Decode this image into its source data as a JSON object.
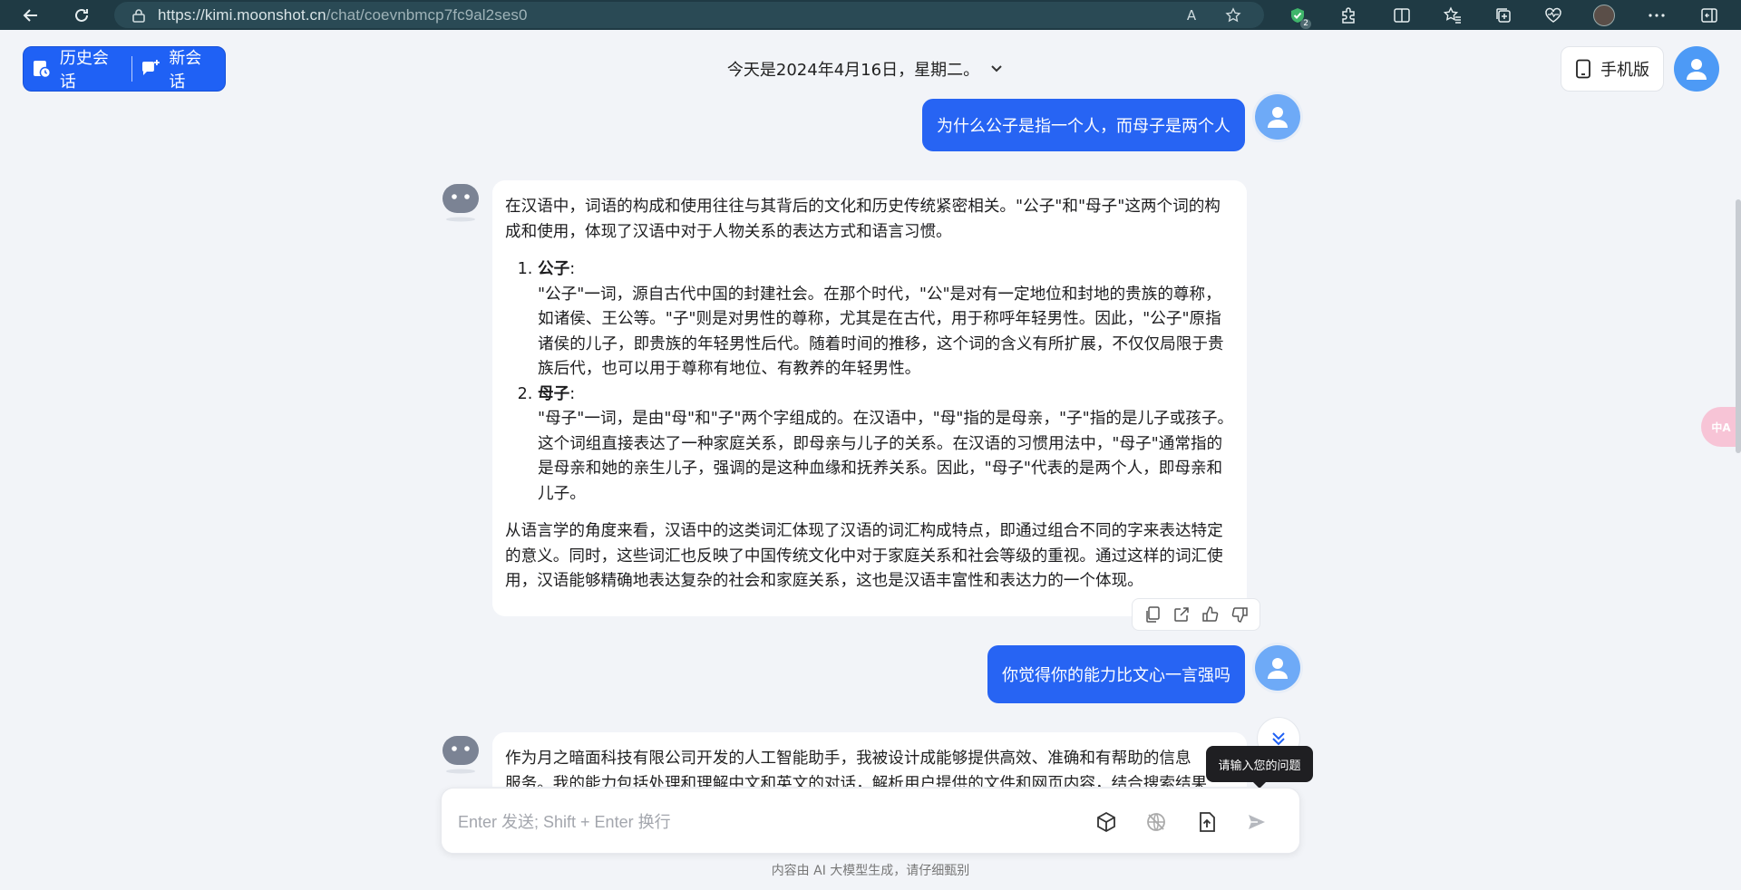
{
  "browser": {
    "url_host": "https://kimi.moonshot.cn",
    "url_path": "/chat/coevnbmcp7fc9al2ses0",
    "extension_badge": "2",
    "read_aloud_label": "A"
  },
  "header": {
    "history_label": "历史会话",
    "new_chat_label": "新会话",
    "date_title": "今天是2024年4月16日，星期二。",
    "mobile_label": "手机版"
  },
  "messages": {
    "user1": "为什么公子是指一个人，而母子是两个人",
    "bot1": {
      "intro": "在汉语中，词语的构成和使用往往与其背后的文化和历史传统紧密相关。\"公子\"和\"母子\"这两个词的构成和使用，体现了汉语中对于人物关系的表达方式和语言习惯。",
      "items": [
        {
          "title": "公子",
          "colon": ":",
          "body": "\"公子\"一词，源自古代中国的封建社会。在那个时代，\"公\"是对有一定地位和封地的贵族的尊称，如诸侯、王公等。\"子\"则是对男性的尊称，尤其是在古代，用于称呼年轻男性。因此，\"公子\"原指诸侯的儿子，即贵族的年轻男性后代。随着时间的推移，这个词的含义有所扩展，不仅仅局限于贵族后代，也可以用于尊称有地位、有教养的年轻男性。"
        },
        {
          "title": "母子",
          "colon": ":",
          "body": "\"母子\"一词，是由\"母\"和\"子\"两个字组成的。在汉语中，\"母\"指的是母亲，\"子\"指的是儿子或孩子。这个词组直接表达了一种家庭关系，即母亲与儿子的关系。在汉语的习惯用法中，\"母子\"通常指的是母亲和她的亲生儿子，强调的是这种血缘和抚养关系。因此，\"母子\"代表的是两个人，即母亲和儿子。"
        }
      ],
      "outro": "从语言学的角度来看，汉语中的这类词汇体现了汉语的词汇构成特点，即通过组合不同的字来表达特定的意义。同时，这些词汇也反映了中国传统文化中对于家庭关系和社会等级的重视。通过这样的词汇使用，汉语能够精确地表达复杂的社会和家庭关系，这也是汉语丰富性和表达力的一个体现。"
    },
    "user2": "你觉得你的能力比文心一言强吗",
    "bot2": {
      "line1": "作为月之暗面科技有限公司开发的人工智能助手，我被设计成能够提供高效、准确和有帮助的信息",
      "line2": "服务。我的能力包括处理和理解中文和英文的对话，解析用户提供的文件和网页内容，结合搜索结果"
    }
  },
  "tooltip": "请输入您的问题",
  "input": {
    "placeholder": "Enter 发送; Shift + Enter 换行",
    "value": ""
  },
  "footer_note": "内容由 AI 大模型生成，请仔细甄别",
  "side_translate_label": "中A",
  "colors": {
    "accent": "#1f61f5",
    "user_bubble": "#2764f3",
    "background": "#f2f4f8",
    "browser_bar": "#1f3a44"
  }
}
